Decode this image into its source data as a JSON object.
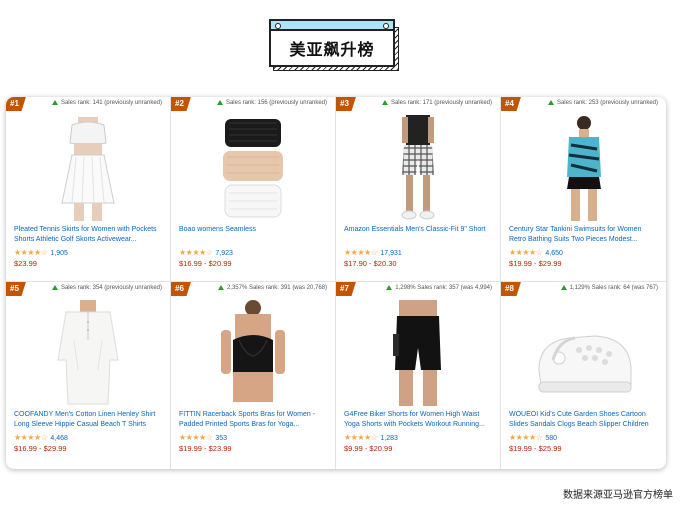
{
  "title": "美亚飙升榜",
  "footer": "数据来源亚马逊官方榜单",
  "colors": {
    "badge": "#c45500",
    "link": "#0a66c2",
    "price": "#b12704",
    "star": "#f3a847",
    "arrow": "#2a9d2a"
  },
  "products": [
    {
      "rank": "#1",
      "sales_rank": "Sales rank: 141 (previously unranked)",
      "name": "Pleated Tennis Skirts for Women with Pockets Shorts Athletic Golf Skorts Activewear...",
      "stars": "★★★★☆",
      "reviews": "1,905",
      "price": "$23.99",
      "image": "white-tennis-outfit"
    },
    {
      "rank": "#2",
      "sales_rank": "Sales rank: 156 (previously unranked)",
      "name": "Boao womens Seamless",
      "stars": "★★★★☆",
      "reviews": "7,923",
      "price": "$16.99 - $20.99",
      "image": "bandeau-bras"
    },
    {
      "rank": "#3",
      "sales_rank": "Sales rank: 171 (previously unranked)",
      "name": "Amazon Essentials Men's Classic-Fit 9\" Short",
      "stars": "★★★★☆",
      "reviews": "17,931",
      "price": "$17.90 - $20.30",
      "image": "plaid-shorts"
    },
    {
      "rank": "#4",
      "sales_rank": "Sales rank: 253 (previously unranked)",
      "name": "Century Star Tankini Swimsuits for Women Retro Bathing Suits Two Pieces Modest...",
      "stars": "★★★★☆",
      "reviews": "4,650",
      "price": "$19.99 - $29.99",
      "image": "tankini"
    },
    {
      "rank": "#5",
      "sales_rank": "Sales rank: 354 (previously unranked)",
      "name": "COOFANDY Men's Cotton Linen Henley Shirt Long Sleeve Hippie Casual Beach T Shirts",
      "stars": "★★★★☆",
      "reviews": "4,468",
      "price": "$16.99 - $29.99",
      "image": "linen-shirt"
    },
    {
      "rank": "#6",
      "sales_rank": "2,357% Sales rank: 391 (was 20,768)",
      "name": "FITTIN Racerback Sports Bras for Women - Padded Printed Sports Bras for Yoga...",
      "stars": "★★★★☆",
      "reviews": "353",
      "price": "$19.99 - $23.99",
      "image": "sports-bra"
    },
    {
      "rank": "#7",
      "sales_rank": "1,298% Sales rank: 357 (was 4,994)",
      "name": "G4Free Biker Shorts for Women High Waist Yoga Shorts with Pockets Workout Running...",
      "stars": "★★★★☆",
      "reviews": "1,283",
      "price": "$9.99 - $20.99",
      "image": "biker-shorts"
    },
    {
      "rank": "#8",
      "sales_rank": "1,129% Sales rank: 64 (was 767)",
      "name": "WOUEOI Kid's Cute Garden Shoes Cartoon Slides Sandals Clogs Beach Slipper Children",
      "stars": "★★★★☆",
      "reviews": "580",
      "price": "$19.99 - $25.99",
      "image": "white-clogs"
    }
  ]
}
